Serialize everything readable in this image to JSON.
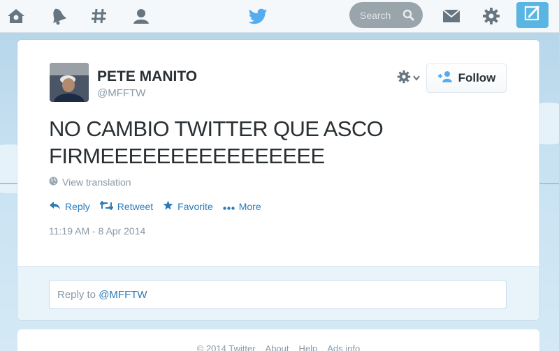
{
  "nav": {
    "icons": [
      "home-icon",
      "notifications-icon",
      "discover-icon",
      "me-icon"
    ],
    "logo": "twitter-bird-icon",
    "search_placeholder": "Search",
    "right_icons": [
      "messages-icon",
      "settings-icon"
    ],
    "compose": "compose-icon"
  },
  "tweet": {
    "fullname": "PETE MANITO",
    "username": "@MFFTW",
    "follow_label": "Follow",
    "text": "NO  CAMBIO TWITTER QUE ASCO\nFIRMEEEEEEEEEEEEEEEE",
    "translate_label": "View translation",
    "actions": {
      "reply": "Reply",
      "retweet": "Retweet",
      "favorite": "Favorite",
      "more": "More"
    },
    "timestamp": "11:19 AM - 8 Apr 2014"
  },
  "reply": {
    "prefix": "Reply to ",
    "mention": "@MFFTW"
  },
  "footer": {
    "items": [
      "© 2014 Twitter",
      "About",
      "Help",
      "Ads info"
    ]
  },
  "colors": {
    "link": "#2b7bb9",
    "brand": "#55acee",
    "compose": "#5ab5e3",
    "text": "#292f33",
    "muted": "#8899a6"
  }
}
